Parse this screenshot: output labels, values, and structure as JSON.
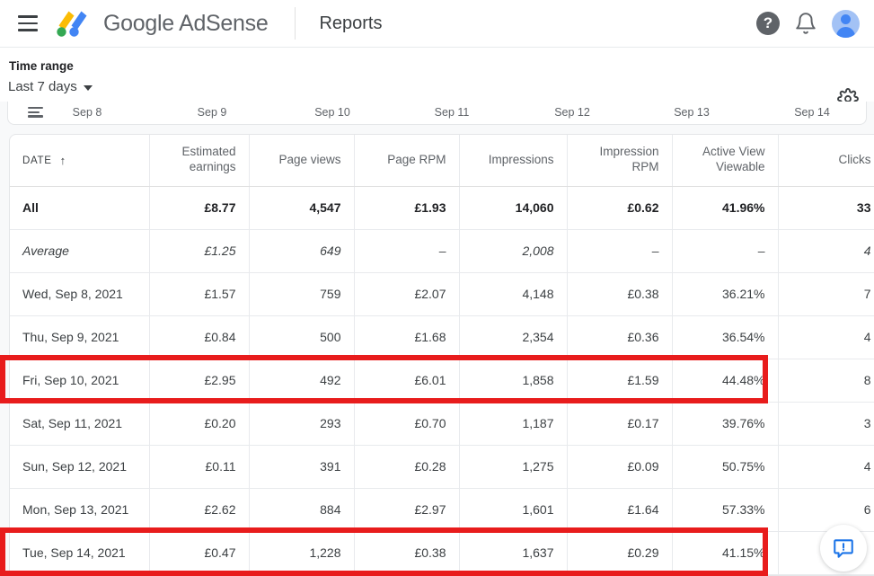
{
  "appbar": {
    "menu_label": "Main menu",
    "brand": "Google AdSense",
    "page_title": "Reports",
    "help_glyph": "?",
    "help_label": "Help",
    "notifications_label": "Notifications",
    "account_label": "Google Account"
  },
  "toolbar": {
    "time_range_label": "Time range",
    "time_range_value": "Last 7 days",
    "settings_label": "Settings"
  },
  "chart_axis": {
    "ticks": [
      "Sep 8",
      "Sep 9",
      "Sep 10",
      "Sep 11",
      "Sep 12",
      "Sep 13",
      "Sep 14"
    ],
    "tick_positions": [
      88,
      227,
      361,
      494,
      628,
      761,
      895
    ],
    "options_label": "Chart options"
  },
  "table": {
    "headers": [
      "DATE",
      "Estimated earnings",
      "Page views",
      "Page RPM",
      "Impressions",
      "Impression RPM",
      "Active View Viewable",
      "Clicks"
    ],
    "sort_arrow": "↑",
    "rows": [
      {
        "date": "All",
        "estimated_earnings": "£8.77",
        "page_views": "4,547",
        "page_rpm": "£1.93",
        "impressions": "14,060",
        "impression_rpm": "£0.62",
        "active_view_viewable": "41.96%",
        "clicks": "33"
      },
      {
        "date": "Average",
        "estimated_earnings": "£1.25",
        "page_views": "649",
        "page_rpm": "–",
        "impressions": "2,008",
        "impression_rpm": "–",
        "active_view_viewable": "–",
        "clicks": "4"
      },
      {
        "date": "Wed, Sep 8, 2021",
        "estimated_earnings": "£1.57",
        "page_views": "759",
        "page_rpm": "£2.07",
        "impressions": "4,148",
        "impression_rpm": "£0.38",
        "active_view_viewable": "36.21%",
        "clicks": "7"
      },
      {
        "date": "Thu, Sep 9, 2021",
        "estimated_earnings": "£0.84",
        "page_views": "500",
        "page_rpm": "£1.68",
        "impressions": "2,354",
        "impression_rpm": "£0.36",
        "active_view_viewable": "36.54%",
        "clicks": "4"
      },
      {
        "date": "Fri, Sep 10, 2021",
        "estimated_earnings": "£2.95",
        "page_views": "492",
        "page_rpm": "£6.01",
        "impressions": "1,858",
        "impression_rpm": "£1.59",
        "active_view_viewable": "44.48%",
        "clicks": "8"
      },
      {
        "date": "Sat, Sep 11, 2021",
        "estimated_earnings": "£0.20",
        "page_views": "293",
        "page_rpm": "£0.70",
        "impressions": "1,187",
        "impression_rpm": "£0.17",
        "active_view_viewable": "39.76%",
        "clicks": "3"
      },
      {
        "date": "Sun, Sep 12, 2021",
        "estimated_earnings": "£0.11",
        "page_views": "391",
        "page_rpm": "£0.28",
        "impressions": "1,275",
        "impression_rpm": "£0.09",
        "active_view_viewable": "50.75%",
        "clicks": "4"
      },
      {
        "date": "Mon, Sep 13, 2021",
        "estimated_earnings": "£2.62",
        "page_views": "884",
        "page_rpm": "£2.97",
        "impressions": "1,601",
        "impression_rpm": "£1.64",
        "active_view_viewable": "57.33%",
        "clicks": "6"
      },
      {
        "date": "Tue, Sep 14, 2021",
        "estimated_earnings": "£0.47",
        "page_views": "1,228",
        "page_rpm": "£0.38",
        "impressions": "1,637",
        "impression_rpm": "£0.29",
        "active_view_viewable": "41.15%",
        "clicks": ""
      }
    ]
  },
  "annotations": {
    "highlight_color": "#e81c1c",
    "highlighted_rows": [
      "Fri, Sep 10, 2021",
      "Tue, Sep 14, 2021"
    ]
  },
  "fab": {
    "label": "Send feedback"
  },
  "colors": {
    "adsense_yellow": "#fbbc04",
    "adsense_green": "#34a853",
    "adsense_blue": "#4285f4",
    "text_primary": "#3c4043",
    "text_secondary": "#5f6368"
  }
}
